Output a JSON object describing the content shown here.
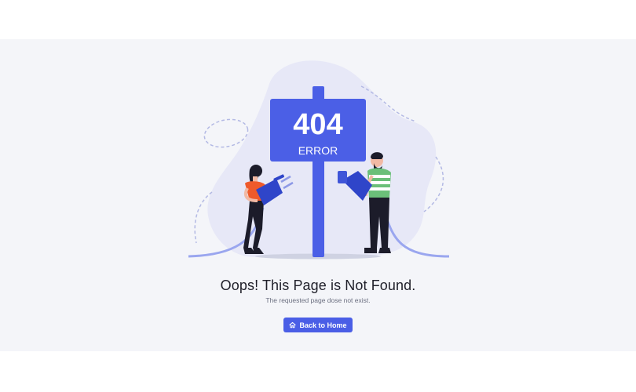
{
  "sign": {
    "code": "404",
    "label": "ERROR"
  },
  "message": {
    "title": "Oops! This Page is Not Found.",
    "subtitle": "The requested page dose not exist."
  },
  "actions": {
    "home_label": "Back to Home",
    "home_icon": "home-icon"
  },
  "colors": {
    "accent": "#4a5ee6",
    "sign_blue": "#4b5fe6",
    "blob": "#e7e8f7",
    "page_bg": "#f4f5f9",
    "cable": "#9aa6ef"
  }
}
